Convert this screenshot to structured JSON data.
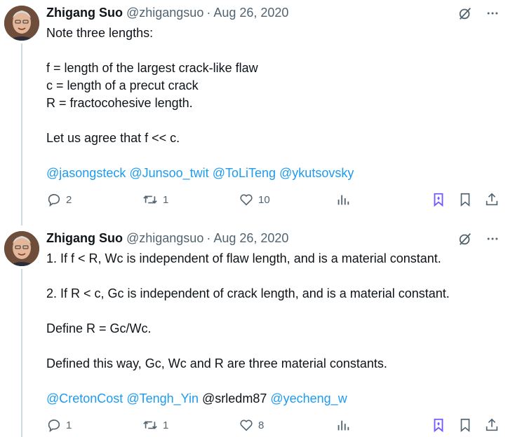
{
  "tweets": [
    {
      "author_name": "Zhigang Suo",
      "handle": "@zhigangsuo",
      "separator": "·",
      "date": "Aug 26, 2020",
      "lines": [
        "Note three lengths:",
        "",
        "f = length of the largest crack-like flaw",
        "c = length of a precut crack",
        "R = fractocohesive length.",
        "",
        "Let us agree that f << c."
      ],
      "mentions": [
        {
          "text": "@jasongsteck",
          "linked": true
        },
        {
          "text": "@Junsoo_twit",
          "linked": true
        },
        {
          "text": "@ToLiTeng",
          "linked": true
        },
        {
          "text": "@ykutsovsky",
          "linked": true
        }
      ],
      "replies": "2",
      "retweets": "1",
      "likes": "10"
    },
    {
      "author_name": "Zhigang Suo",
      "handle": "@zhigangsuo",
      "separator": "·",
      "date": "Aug 26, 2020",
      "lines": [
        "1. If f < R, Wc is independent of flaw length, and is a material constant.",
        "",
        "2. If R < c, Gc is independent of crack length, and is a material constant.",
        "",
        "Define R = Gc/Wc.",
        "",
        "Defined this way, Gc, Wc and R are three material constants."
      ],
      "mentions": [
        {
          "text": "@CretonCost",
          "linked": true
        },
        {
          "text": "@Tengh_Yin",
          "linked": true
        },
        {
          "text": "@srledm87",
          "linked": false
        },
        {
          "text": "@yecheng_w",
          "linked": true
        }
      ],
      "replies": "1",
      "retweets": "1",
      "likes": "8"
    }
  ],
  "icons": {
    "top": [
      "grok-icon",
      "more-icon"
    ],
    "actions": [
      "reply-icon",
      "retweet-icon",
      "like-icon",
      "views-icon",
      "bookmark-folder-icon",
      "bookmark-icon",
      "share-icon"
    ]
  },
  "colors": {
    "link": "#1d9bf0",
    "secondary_text": "#536471",
    "thread_line": "#cfd9de",
    "accent_purple": "#7856ff"
  }
}
